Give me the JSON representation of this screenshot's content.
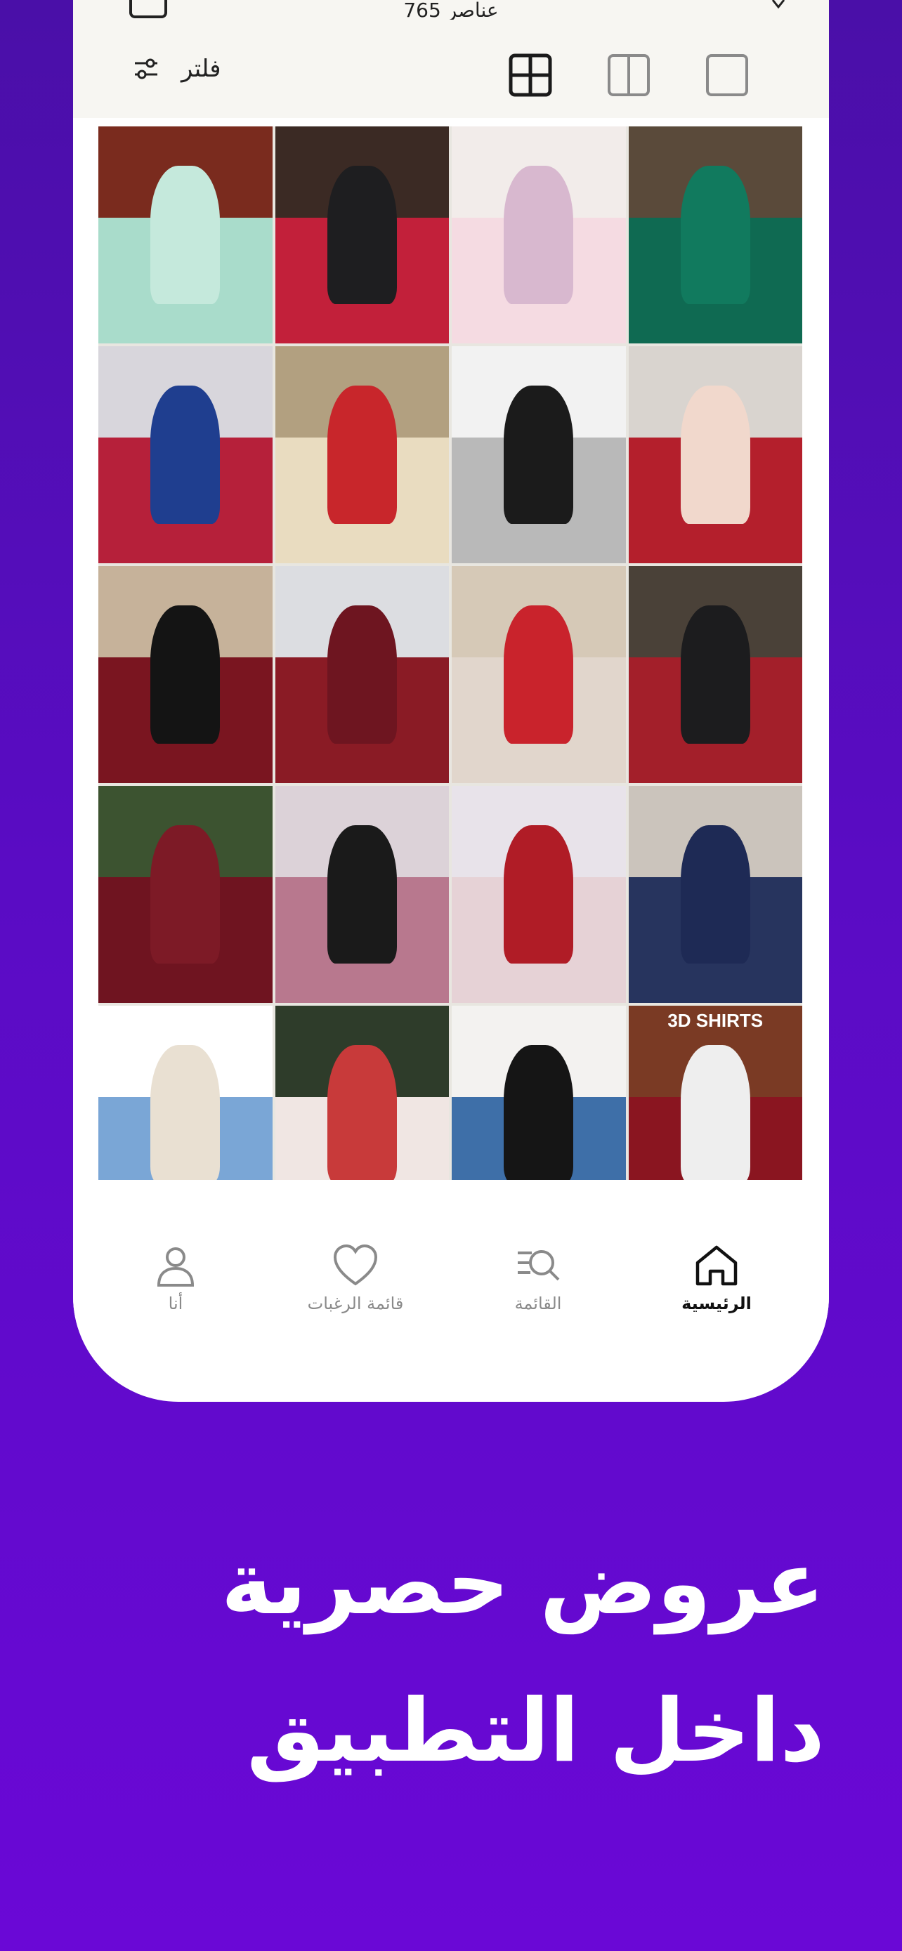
{
  "header": {
    "items_count": "765 عناصر"
  },
  "toolbar": {
    "filter_label": "فلتر"
  },
  "products": [
    {
      "top": "#7a2b1e",
      "bottom": "#a9dccb",
      "accent": "#c5e9dc",
      "label": ""
    },
    {
      "top": "#3b2a24",
      "bottom": "#c2203a",
      "accent": "#1e1e20",
      "label": ""
    },
    {
      "top": "#f2ecea",
      "bottom": "#f5dbe2",
      "accent": "#d8b8cf",
      "label": ""
    },
    {
      "top": "#5a4a3a",
      "bottom": "#0f6a52",
      "accent": "#117a5e",
      "label": ""
    },
    {
      "top": "#d8d6dc",
      "bottom": "#b6203a",
      "accent": "#1f3e8f",
      "label": ""
    },
    {
      "top": "#b2a080",
      "bottom": "#e9dcc0",
      "accent": "#c8262b",
      "label": ""
    },
    {
      "top": "#f2f2f2",
      "bottom": "#b9b9b9",
      "accent": "#1b1b1b",
      "label": ""
    },
    {
      "top": "#d9d4cf",
      "bottom": "#b41f2c",
      "accent": "#f1d8cc",
      "label": ""
    },
    {
      "top": "#c6b29a",
      "bottom": "#7a1520",
      "accent": "#141414",
      "label": ""
    },
    {
      "top": "#dcdde1",
      "bottom": "#8a1b25",
      "accent": "#6e1520",
      "label": ""
    },
    {
      "top": "#d6c9b7",
      "bottom": "#e1d6cc",
      "accent": "#c9232c",
      "label": ""
    },
    {
      "top": "#4a4138",
      "bottom": "#a31f2a",
      "accent": "#1c1c1e",
      "label": ""
    },
    {
      "top": "#3c5330",
      "bottom": "#6f1420",
      "accent": "#7d1a26",
      "label": ""
    },
    {
      "top": "#dcd2d8",
      "bottom": "#b8788e",
      "accent": "#1a1a1a",
      "label": ""
    },
    {
      "top": "#e8e3ea",
      "bottom": "#e6d2d6",
      "accent": "#b01c26",
      "label": ""
    },
    {
      "top": "#cbc4bc",
      "bottom": "#27345e",
      "accent": "#1e2a55",
      "label": ""
    },
    {
      "top": "#ffffff",
      "bottom": "#7aa6d6",
      "accent": "#e9e0d2",
      "label": ""
    },
    {
      "top": "#2e3c2a",
      "bottom": "#f0e6e3",
      "accent": "#c83a3a",
      "label": ""
    },
    {
      "top": "#f3f2f0",
      "bottom": "#3e6fa8",
      "accent": "#151515",
      "label": ""
    },
    {
      "top": "#7a3a24",
      "bottom": "#8a1520",
      "accent": "#eeeeee",
      "label": "3D SHIRTS"
    }
  ],
  "bottom_nav": {
    "me": "أنا",
    "wishlist": "قائمة الرغبات",
    "list": "القائمة",
    "home": "الرئيسية"
  },
  "promo": {
    "line1": "عروض حصرية",
    "line2": "داخل التطبيق"
  },
  "colors": {
    "background": "#5a0cc4",
    "toolbar_bg": "#f7f6f2",
    "nav_active": "#111111",
    "nav_inactive": "#8a8a8a"
  }
}
